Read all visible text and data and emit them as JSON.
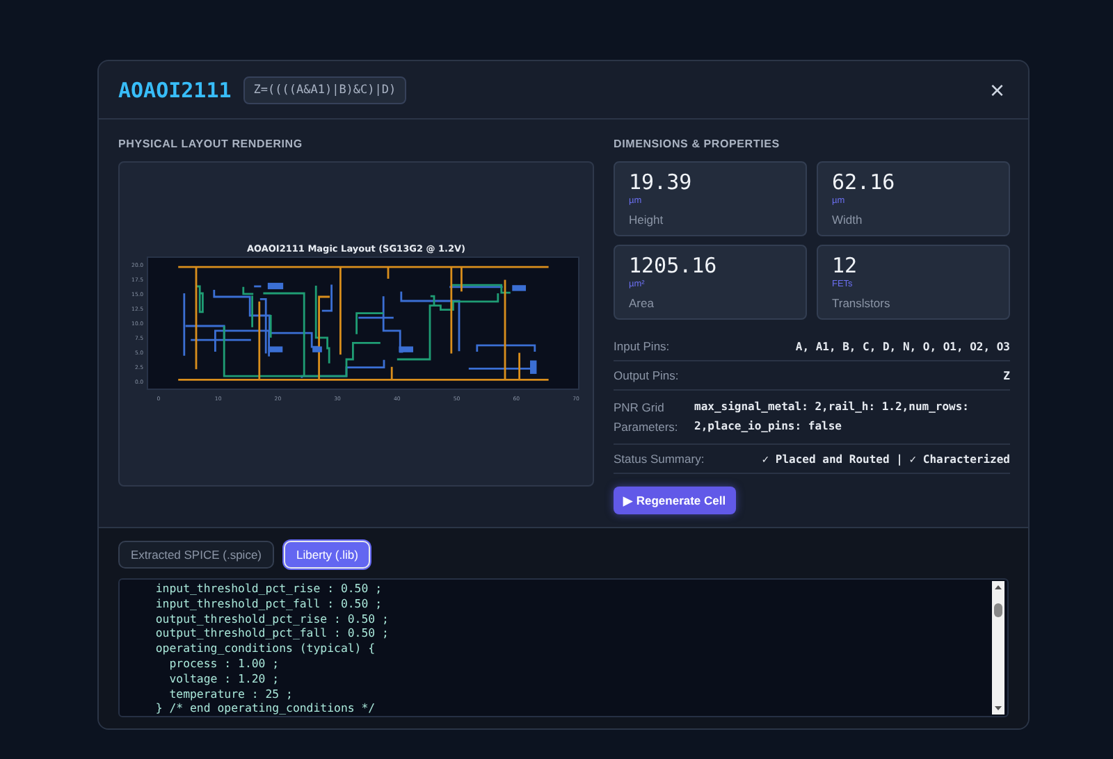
{
  "dialog": {
    "title": "AOAOI2111",
    "expression": "Z=((((A&A1)|B)&C)|D)",
    "close": "×"
  },
  "layout_panel": {
    "heading": "PHYSICAL LAYOUT RENDERING",
    "plot": {
      "title": "AOAOI2111 Magic Layout (SG13G2 @ 1.2V)",
      "xticks": [
        "0",
        "10",
        "20",
        "30",
        "40",
        "50",
        "60",
        "70"
      ],
      "yticks": [
        "20.0",
        "17.5",
        "15.0",
        "12.5",
        "10.0",
        "7.5",
        "5.0",
        "2.5",
        "0.0"
      ]
    }
  },
  "properties": {
    "heading": "DIMENSIONS & PROPERTIES",
    "stats": [
      {
        "value": "19.39",
        "unit": "µm",
        "label": "Height"
      },
      {
        "value": "62.16",
        "unit": "µm",
        "label": "Width"
      },
      {
        "value": "1205.16",
        "unit": "µm²",
        "label": "Area"
      },
      {
        "value": "12",
        "unit": "FETs",
        "label": "Translstors"
      }
    ],
    "rows": [
      {
        "label": "Input Pins:",
        "value": "A, A1, B, C, D, N, O, O1, O2, O3",
        "kind": "right"
      },
      {
        "label": "Output Pins:",
        "value": "Z",
        "kind": "right"
      },
      {
        "label": "PNR Grid Parameters:",
        "value": "max_signal_metal: 2,rail_h: 1.2,num_rows: 2,place_io_pins: false",
        "kind": "wrap"
      },
      {
        "label": "Status Summary:",
        "value": "✓ Placed and Routed | ✓ Characterized",
        "kind": "right"
      }
    ],
    "action": "▶ Regenerate Cell"
  },
  "code_panel": {
    "tabs": [
      {
        "label": "Extracted SPICE (.spice)",
        "selected": false
      },
      {
        "label": "Liberty (.lib)",
        "selected": true
      }
    ],
    "lines": [
      "  input_threshold_pct_rise : 0.50 ;",
      "  input_threshold_pct_fall : 0.50 ;",
      "  output_threshold_pct_rise : 0.50 ;",
      "  output_threshold_pct_fall : 0.50 ;",
      "  operating_conditions (typical) {",
      "    process : 1.00 ;",
      "    voltage : 1.20 ;",
      "    temperature : 25 ;",
      "  } /* end operating_conditions */"
    ]
  }
}
